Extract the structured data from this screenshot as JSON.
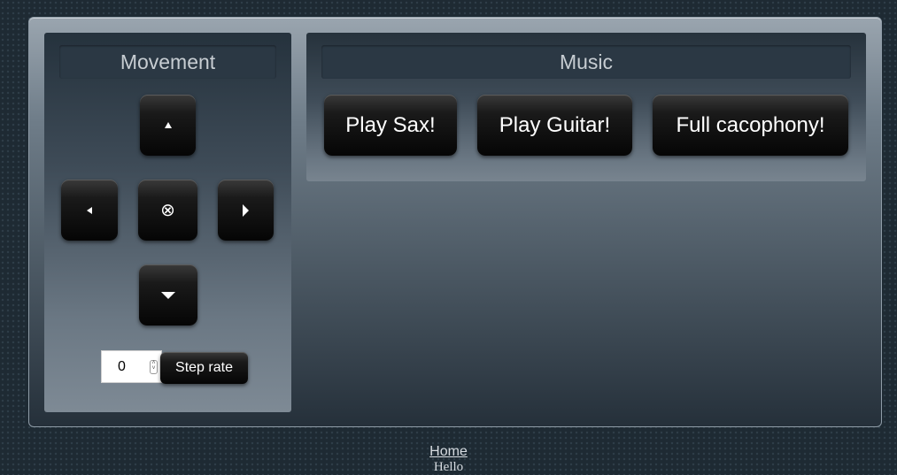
{
  "movement": {
    "title": "Movement",
    "up_icon": "triangle-up",
    "left_icon": "triangle-left",
    "stop_icon": "circled-x",
    "stop_glyph": "⊗",
    "right_icon": "triangle-right",
    "down_icon": "triangle-down",
    "step_value": "0",
    "step_button_label": "Step rate"
  },
  "music": {
    "title": "Music",
    "buttons": [
      {
        "label": "Play Sax!"
      },
      {
        "label": "Play Guitar!"
      },
      {
        "label": "Full cacophony!"
      }
    ]
  },
  "footer": {
    "home_link": "Home",
    "text": "Hello"
  },
  "colors": {
    "button_bg": "#050505",
    "panel_title_bg": "#2b3844",
    "page_bg": "#1e2a33"
  }
}
